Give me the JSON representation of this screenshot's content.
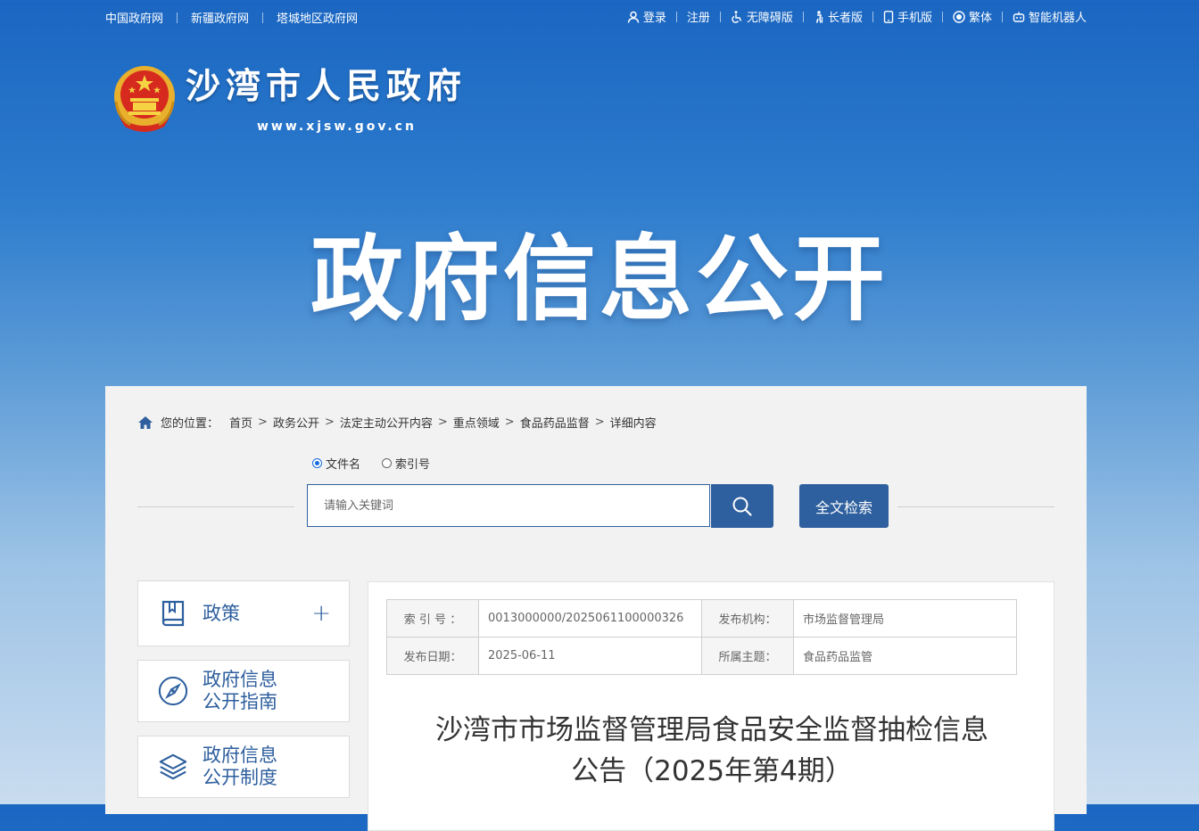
{
  "top_links": [
    "中国政府网",
    "新疆政府网",
    "塔城地区政府网"
  ],
  "top_tools": {
    "login": "登录",
    "register": "注册",
    "accessible": "无障碍版",
    "elder": "长者版",
    "mobile": "手机版",
    "traditional": "繁体",
    "robot": "智能机器人"
  },
  "site": {
    "name": "沙湾市人民政府",
    "url": "www.xjsw.gov.cn"
  },
  "banner_title": "政府信息公开",
  "breadcrumb": {
    "label": "您的位置：",
    "items": [
      "首页",
      "政务公开",
      "法定主动公开内容",
      "重点领域",
      "食品药品监督",
      "详细内容"
    ]
  },
  "search": {
    "option_filename": "文件名",
    "option_index": "索引号",
    "selected": "文件名",
    "placeholder": "请输入关键词",
    "fulltext_label": "全文检索"
  },
  "sidebar": [
    {
      "label": "政策",
      "icon": "book-icon"
    },
    {
      "label_line1": "政府信息",
      "label_line2": "公开指南",
      "icon": "compass-icon"
    },
    {
      "label_line1": "政府信息",
      "label_line2": "公开制度",
      "icon": "layers-icon"
    }
  ],
  "meta": {
    "index_label": "索 引 号 ：",
    "index_value": "0013000000/2025061100000326",
    "publisher_label": "发布机构：",
    "publisher_value": "市场监督管理局",
    "date_label": "发布日期：",
    "date_value": "2025-06-11",
    "topic_label": "所属主题：",
    "topic_value": "食品药品监管"
  },
  "document": {
    "title_line1": "沙湾市市场监督管理局食品安全监督抽检信息",
    "title_line2": "公告（2025年第4期）"
  },
  "colors": {
    "primary": "#2e5f9e",
    "header_blue": "#1a66c2"
  }
}
